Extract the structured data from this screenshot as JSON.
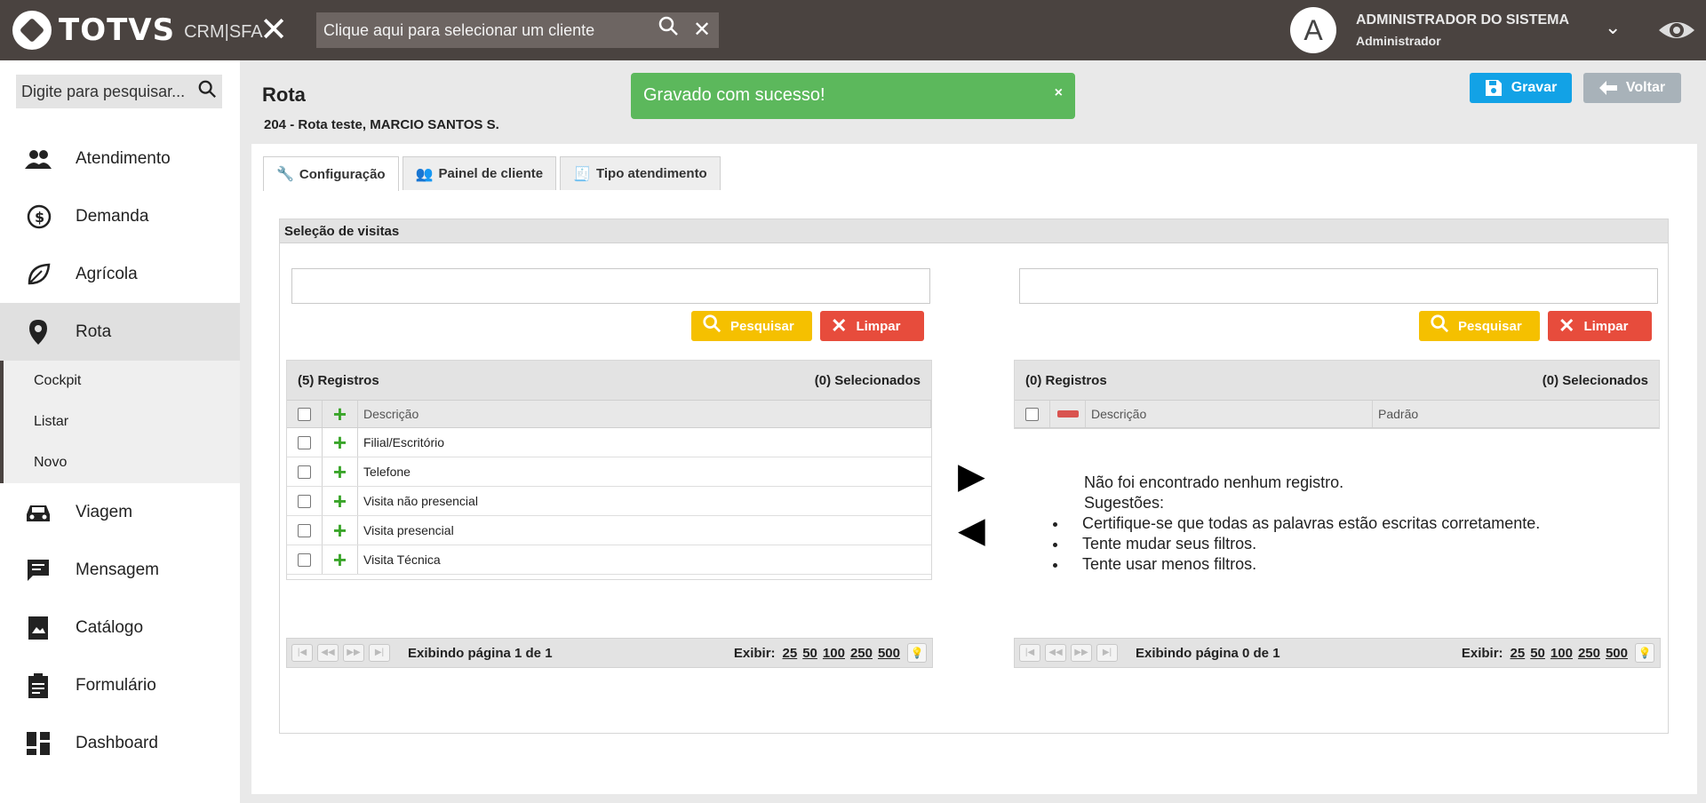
{
  "topbar": {
    "logo_text": "TOTVS",
    "logo_sub": "CRM|SFA",
    "client_search_placeholder": "Clique aqui para selecionar um cliente",
    "avatar_letter": "A",
    "user_name": "ADMINISTRADOR DO SISTEMA",
    "user_role": "Administrador"
  },
  "sidebar": {
    "search_placeholder": "Digite para pesquisar...",
    "items": [
      {
        "label": "Atendimento",
        "icon": "people-icon"
      },
      {
        "label": "Demanda",
        "icon": "money-history-icon"
      },
      {
        "label": "Agrícola",
        "icon": "leaf-icon"
      },
      {
        "label": "Rota",
        "icon": "map-pin-icon"
      },
      {
        "label": "Viagem",
        "icon": "car-icon"
      },
      {
        "label": "Mensagem",
        "icon": "message-icon"
      },
      {
        "label": "Catálogo",
        "icon": "catalog-icon"
      },
      {
        "label": "Formulário",
        "icon": "clipboard-icon"
      },
      {
        "label": "Dashboard",
        "icon": "dashboard-icon"
      }
    ],
    "sub_items": [
      "Cockpit",
      "Listar",
      "Novo"
    ]
  },
  "page": {
    "title": "Rota",
    "subtitle": "204 - Rota teste, MARCIO SANTOS S.",
    "toast": "Gravado com sucesso!",
    "toast_close": "×",
    "save_label": "Gravar",
    "back_label": "Voltar"
  },
  "tabs": [
    "Configuração",
    "Painel de cliente",
    "Tipo atendimento"
  ],
  "section_title": "Seleção de visitas",
  "left": {
    "search_value": "",
    "search_btn": "Pesquisar",
    "clear_btn": "Limpar",
    "count": "(5) Registros",
    "selected": "(0) Selecionados",
    "col_desc": "Descrição",
    "rows": [
      "Filial/Escritório",
      "Telefone",
      "Visita não presencial",
      "Visita presencial",
      "Visita Técnica"
    ],
    "pager_info": "Exibindo página 1 de 1",
    "show_label": "Exibir:",
    "sizes": [
      "25",
      "50",
      "100",
      "250",
      "500"
    ]
  },
  "right": {
    "search_value": "",
    "search_btn": "Pesquisar",
    "clear_btn": "Limpar",
    "count": "(0) Registros",
    "selected": "(0) Selecionados",
    "col_desc": "Descrição",
    "col_default": "Padrão",
    "empty_title": "Não foi encontrado nenhum registro.",
    "empty_sub": "Sugestões:",
    "empty_tips": [
      "Certifique-se que todas as palavras estão escritas corretamente.",
      "Tente mudar seus filtros.",
      "Tente usar menos filtros."
    ],
    "pager_info": "Exibindo página 0 de 1",
    "show_label": "Exibir:",
    "sizes": [
      "25",
      "50",
      "100",
      "250",
      "500"
    ]
  },
  "colors": {
    "topbar": "#4a4340",
    "success": "#5cb85c",
    "save": "#12a2e6",
    "back": "#a8b2b9",
    "search": "#f5c000",
    "clear": "#e74c3c"
  }
}
